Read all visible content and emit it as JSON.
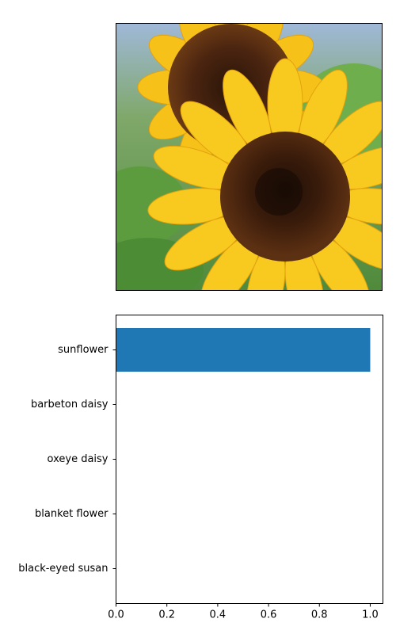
{
  "image_panel": {
    "subject_icon": "sunflower-photo"
  },
  "chart_data": {
    "type": "bar",
    "orientation": "horizontal",
    "categories": [
      "sunflower",
      "barbeton daisy",
      "oxeye daisy",
      "blanket flower",
      "black-eyed susan"
    ],
    "values": [
      1.0,
      0.0,
      0.0,
      0.0,
      0.0
    ],
    "xlim": [
      0,
      1.05
    ],
    "xticks": [
      "0.0",
      "0.2",
      "0.4",
      "0.6",
      "0.8",
      "1.0"
    ],
    "bar_color": "#1f77b4",
    "grid": false,
    "legend": "none"
  }
}
